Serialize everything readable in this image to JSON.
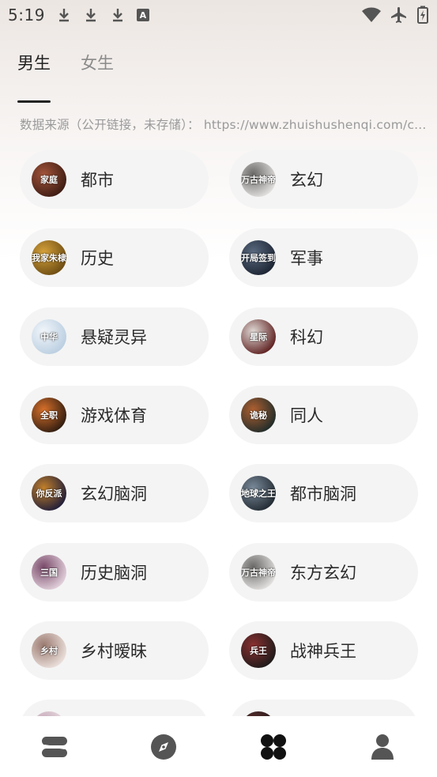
{
  "status_bar": {
    "time": "5:19",
    "badge_letter": "A"
  },
  "tabs": [
    {
      "label": "男生",
      "active": true
    },
    {
      "label": "女生",
      "active": false
    }
  ],
  "source_note": "数据来源（公开链接，未存储）：  https://www.zhuishushenqi.com/c...",
  "categories": [
    {
      "label": "都市",
      "cover_text": "家庭",
      "cover_colors": [
        "#3a1a12",
        "#a2543a"
      ]
    },
    {
      "label": "玄幻",
      "cover_text": "万古神帝",
      "cover_colors": [
        "#e8e6e4",
        "#6a6866"
      ]
    },
    {
      "label": "历史",
      "cover_text": "我家朱棣",
      "cover_colors": [
        "#6a4a12",
        "#d6a23a"
      ]
    },
    {
      "label": "军事",
      "cover_text": "开局签到",
      "cover_colors": [
        "#1a2230",
        "#5a6a80"
      ]
    },
    {
      "label": "悬疑灵异",
      "cover_text": "中华",
      "cover_colors": [
        "#b8cde0",
        "#f2f6fa"
      ]
    },
    {
      "label": "科幻",
      "cover_text": "星际",
      "cover_colors": [
        "#5a1a1a",
        "#e0dad6"
      ]
    },
    {
      "label": "游戏体育",
      "cover_text": "全职",
      "cover_colors": [
        "#2a1a10",
        "#d8702a"
      ]
    },
    {
      "label": "同人",
      "cover_text": "诡秘",
      "cover_colors": [
        "#1a2a2a",
        "#b06030"
      ]
    },
    {
      "label": "玄幻脑洞",
      "cover_text": "你反派",
      "cover_colors": [
        "#1a1a3a",
        "#c2802a"
      ]
    },
    {
      "label": "都市脑洞",
      "cover_text": "地球之王",
      "cover_colors": [
        "#202830",
        "#7a8a9a"
      ]
    },
    {
      "label": "历史脑洞",
      "cover_text": "三国",
      "cover_colors": [
        "#e6d6e0",
        "#7a4a6a"
      ]
    },
    {
      "label": "东方玄幻",
      "cover_text": "万古神帝",
      "cover_colors": [
        "#e8e6e4",
        "#6a6866"
      ]
    },
    {
      "label": "乡村暧昧",
      "cover_text": "乡村",
      "cover_colors": [
        "#efe4e0",
        "#9a7a70"
      ]
    },
    {
      "label": "战神兵王",
      "cover_text": "兵王",
      "cover_colors": [
        "#1a1a1a",
        "#8a3030"
      ]
    },
    {
      "label": "",
      "cover_text": "",
      "cover_colors": [
        "#f0e8ec",
        "#c0a0b0"
      ]
    },
    {
      "label": "",
      "cover_text": "",
      "cover_colors": [
        "#201818",
        "#603030"
      ]
    }
  ],
  "bottom_nav": [
    {
      "icon": "bookshelf-icon"
    },
    {
      "icon": "compass-icon"
    },
    {
      "icon": "category-grid-icon",
      "active": true
    },
    {
      "icon": "profile-icon"
    }
  ],
  "colors": {
    "active_text": "#222222",
    "inactive_text": "#8a8a8a",
    "pill_bg": "#f4f4f4",
    "nav_icon": "#5a5a5a"
  }
}
